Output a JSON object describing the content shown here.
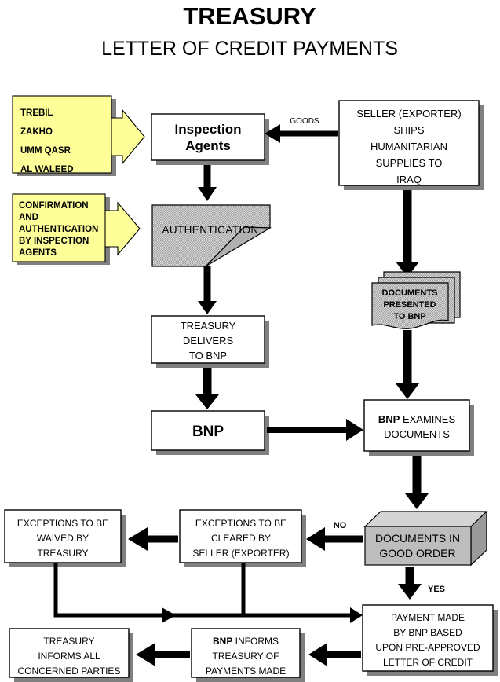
{
  "title": {
    "line1": "TREASURY",
    "line2": "LETTER OF CREDIT PAYMENTS"
  },
  "colors": {
    "callout_yellow": "#ffff99",
    "shadow_gray": "#808080",
    "document_gray": "#c8c8c8",
    "cube_front": "#bdbdbd",
    "cube_top": "#d4d4d4",
    "cube_side": "#9a9a9a",
    "line_black": "#000000"
  },
  "callouts": {
    "sites": {
      "name": "border-crossing-sites",
      "lines": [
        "TREBIL",
        "ZAKHO",
        "UMM QASR",
        "AL WALEED"
      ]
    },
    "confirmation": {
      "name": "confirmation-note",
      "lines": [
        "CONFIRMATION",
        "AND",
        "AUTHENTICATION",
        "BY INSPECTION",
        "AGENTS"
      ]
    }
  },
  "nodes": {
    "inspection_agents": {
      "lines": [
        "Inspection",
        "Agents"
      ]
    },
    "seller_ships": {
      "lines": [
        "SELLER (EXPORTER)",
        "SHIPS",
        "HUMANITARIAN",
        "SUPPLIES TO",
        "IRAQ"
      ]
    },
    "authentication": {
      "lines": [
        "AUTHENTICATION"
      ]
    },
    "documents_presented": {
      "lines": [
        "DOCUMENTS",
        "PRESENTED",
        "TO BNP"
      ]
    },
    "treasury_delivers": {
      "lines": [
        "TREASURY",
        "DELIVERS",
        "TO BNP"
      ]
    },
    "bnp": {
      "lines": [
        "BNP"
      ]
    },
    "bnp_examines": {
      "bold_part": "BNP",
      "rest_part": " EXAMINES",
      "line2": "DOCUMENTS"
    },
    "documents_good_order": {
      "lines": [
        "DOCUMENTS IN",
        "GOOD ORDER"
      ]
    },
    "exceptions_waived": {
      "lines": [
        "EXCEPTIONS TO BE",
        "WAIVED BY",
        "TREASURY"
      ]
    },
    "exceptions_cleared": {
      "lines": [
        "EXCEPTIONS TO BE",
        "CLEARED BY",
        "SELLER (EXPORTER)"
      ]
    },
    "payment_made": {
      "lines": [
        "PAYMENT MADE",
        "BY BNP BASED",
        "UPON PRE-APPROVED",
        "LETTER OF CREDIT"
      ]
    },
    "bnp_informs": {
      "bold_part": "BNP",
      "rest_part": " INFORMS",
      "line2": "TREASURY OF",
      "line3": "PAYMENTS MADE"
    },
    "treasury_informs": {
      "lines": [
        "TREASURY",
        "INFORMS ALL",
        "CONCERNED PARTIES"
      ]
    }
  },
  "edge_labels": {
    "goods": "GOODS",
    "no": "NO",
    "yes": "YES"
  }
}
